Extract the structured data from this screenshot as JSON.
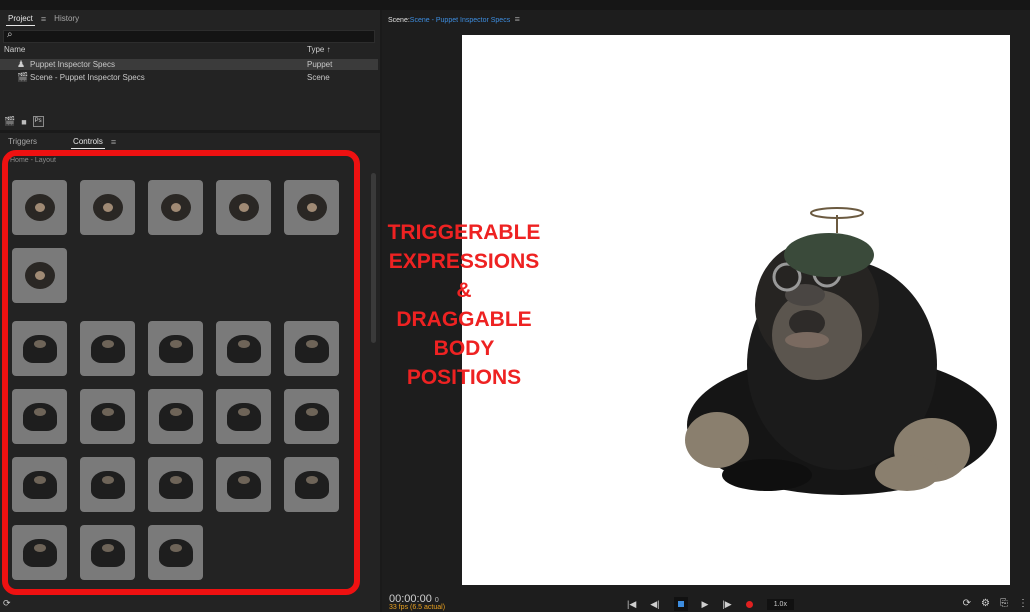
{
  "project_panel": {
    "tabs": [
      {
        "label": "Project",
        "active": true
      },
      {
        "label": "History",
        "active": false
      }
    ],
    "search_icon": "search-icon",
    "columns": {
      "name": "Name",
      "type": "Type"
    },
    "rows": [
      {
        "icon": "puppet-icon",
        "name": "Puppet Inspector Specs",
        "type": "Puppet",
        "selected": true
      },
      {
        "icon": "scene-icon",
        "name": "Scene - Puppet Inspector Specs",
        "type": "Scene",
        "selected": false
      }
    ],
    "bottom_ps_label": "Ps"
  },
  "controls_panel": {
    "tabs": [
      {
        "label": "Triggers",
        "active": false
      },
      {
        "label": "Controls",
        "active": true
      }
    ],
    "sublabel": "Home - Layout",
    "expression_count": 6,
    "body_position_count": 18
  },
  "overlay_text": [
    "TRIGGERABLE",
    "EXPRESSIONS",
    "&",
    "DRAGGABLE",
    "BODY",
    "POSITIONS"
  ],
  "scene_panel": {
    "title_prefix": "Scene:",
    "title_link": "Scene - Puppet Inspector Specs",
    "timecode": "00:00:00",
    "timecode_frame": "0",
    "fps": "33 fps (6.5 actual)",
    "speed": "1.0x"
  },
  "colors": {
    "accent": "#3d8ddf",
    "annotation": "#ee1111",
    "fps": "#e8a020",
    "record": "#e02020"
  }
}
